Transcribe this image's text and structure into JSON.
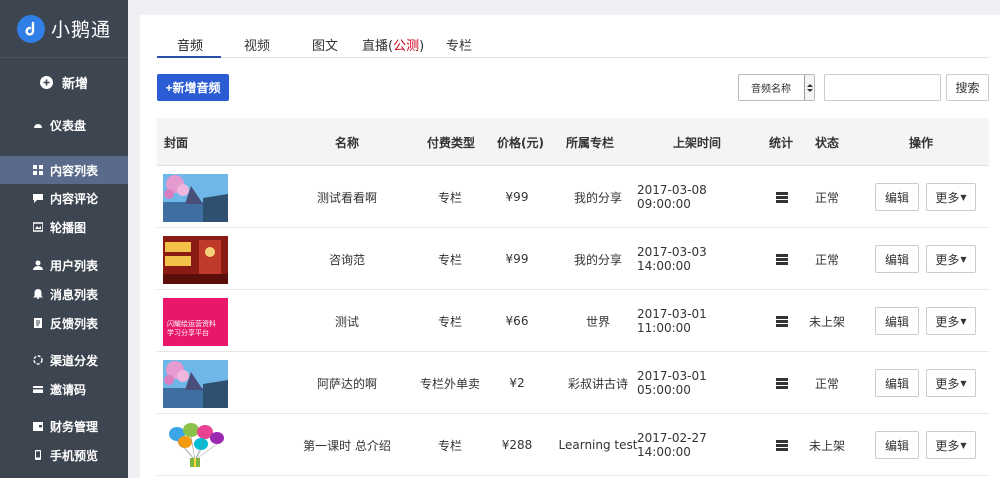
{
  "brand": {
    "title": "小鹅通"
  },
  "sidebar": {
    "add_label": "新增",
    "items": [
      {
        "label": "仪表盘",
        "icon": "dashboard-icon"
      },
      {
        "label": "内容列表",
        "icon": "grid-icon",
        "active": true
      },
      {
        "label": "内容评论",
        "icon": "comment-icon"
      },
      {
        "label": "轮播图",
        "icon": "image-icon"
      },
      {
        "label": "用户列表",
        "icon": "user-icon"
      },
      {
        "label": "消息列表",
        "icon": "bell-icon"
      },
      {
        "label": "反馈列表",
        "icon": "feedback-icon"
      },
      {
        "label": "渠道分发",
        "icon": "share-icon"
      },
      {
        "label": "邀请码",
        "icon": "card-icon"
      },
      {
        "label": "财务管理",
        "icon": "wallet-icon"
      },
      {
        "label": "手机预览",
        "icon": "phone-icon"
      }
    ]
  },
  "tabs": {
    "audio": "音频",
    "video": "视频",
    "article": "图文",
    "live": "直播(",
    "live_beta": "公测",
    "live_close": ")",
    "column": "专栏"
  },
  "toolbar": {
    "add_audio": "+新增音频",
    "filter_selected": "音频名称",
    "search_button": "搜索"
  },
  "table": {
    "headers": {
      "cover": "封面",
      "name": "名称",
      "pay_type": "付费类型",
      "price": "价格(元)",
      "column": "所属专栏",
      "time": "上架时间",
      "stats": "统计",
      "status": "状态",
      "actions": "操作"
    },
    "rows": [
      {
        "name": "测试看看啊",
        "pay_type": "专栏",
        "price": "¥99",
        "column": "我的分享",
        "time": "2017-03-08 09:00:00",
        "status": "正常",
        "edit": "编辑",
        "more": "更多"
      },
      {
        "name": "咨询范",
        "pay_type": "专栏",
        "price": "¥99",
        "column": "我的分享",
        "time": "2017-03-03 14:00:00",
        "status": "正常",
        "edit": "编辑",
        "more": "更多"
      },
      {
        "name": "测试",
        "pay_type": "专栏",
        "price": "¥66",
        "column": "世界",
        "time": "2017-03-01 11:00:00",
        "status": "未上架",
        "edit": "编辑",
        "more": "更多",
        "thumb_text": "闪耀绘运营资料\n学习分享平台"
      },
      {
        "name": "阿萨达的啊",
        "pay_type": "专栏外单卖",
        "price": "¥2",
        "column": "彩叔讲古诗",
        "time": "2017-03-01 05:00:00",
        "status": "正常",
        "edit": "编辑",
        "more": "更多"
      },
      {
        "name": "第一课时 总介绍",
        "pay_type": "专栏",
        "price": "¥288",
        "column": "Learning test",
        "time": "2017-02-27 14:00:00",
        "status": "未上架",
        "edit": "编辑",
        "more": "更多"
      }
    ]
  },
  "colors": {
    "sidebar_bg": "#3d4550",
    "active_nav": "#5a6a8a",
    "primary": "#2b5cd4",
    "beta_red": "#d0021b"
  }
}
